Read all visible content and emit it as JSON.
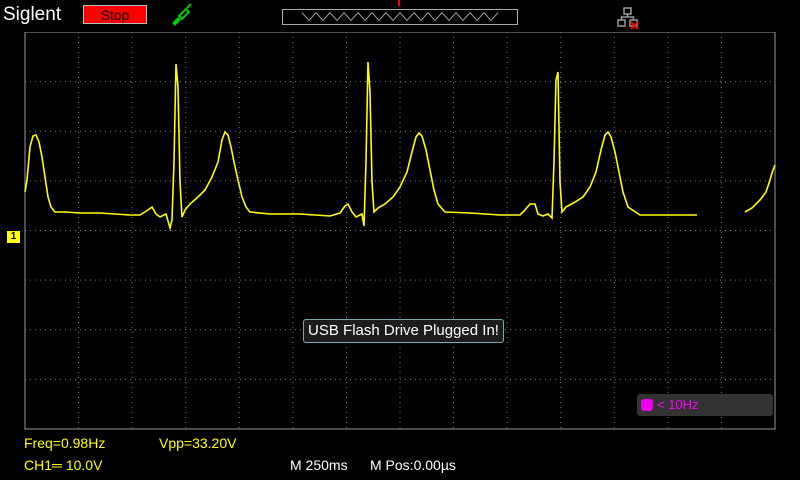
{
  "header": {
    "brand": "Siglent",
    "run_state": "Stop"
  },
  "channel": {
    "badge": "1",
    "color": "#ffff00"
  },
  "message": {
    "text": "USB Flash Drive Plugged In!"
  },
  "trigger_status": {
    "text": "< 10Hz",
    "color": "#ff00ff"
  },
  "measurements": {
    "freq": "Freq=0.98Hz",
    "vpp": "Vpp=33.20V",
    "ch1_scale": "CH1═ 10.0V"
  },
  "timebase": {
    "main": "M 250ms",
    "position": "M Pos:0.00µs"
  },
  "colors": {
    "grid": "#7a7a7a",
    "trace": "#ffff00",
    "stop": "#ff0000"
  },
  "icons": [
    "probe-icon",
    "network-disconnected-icon"
  ]
}
